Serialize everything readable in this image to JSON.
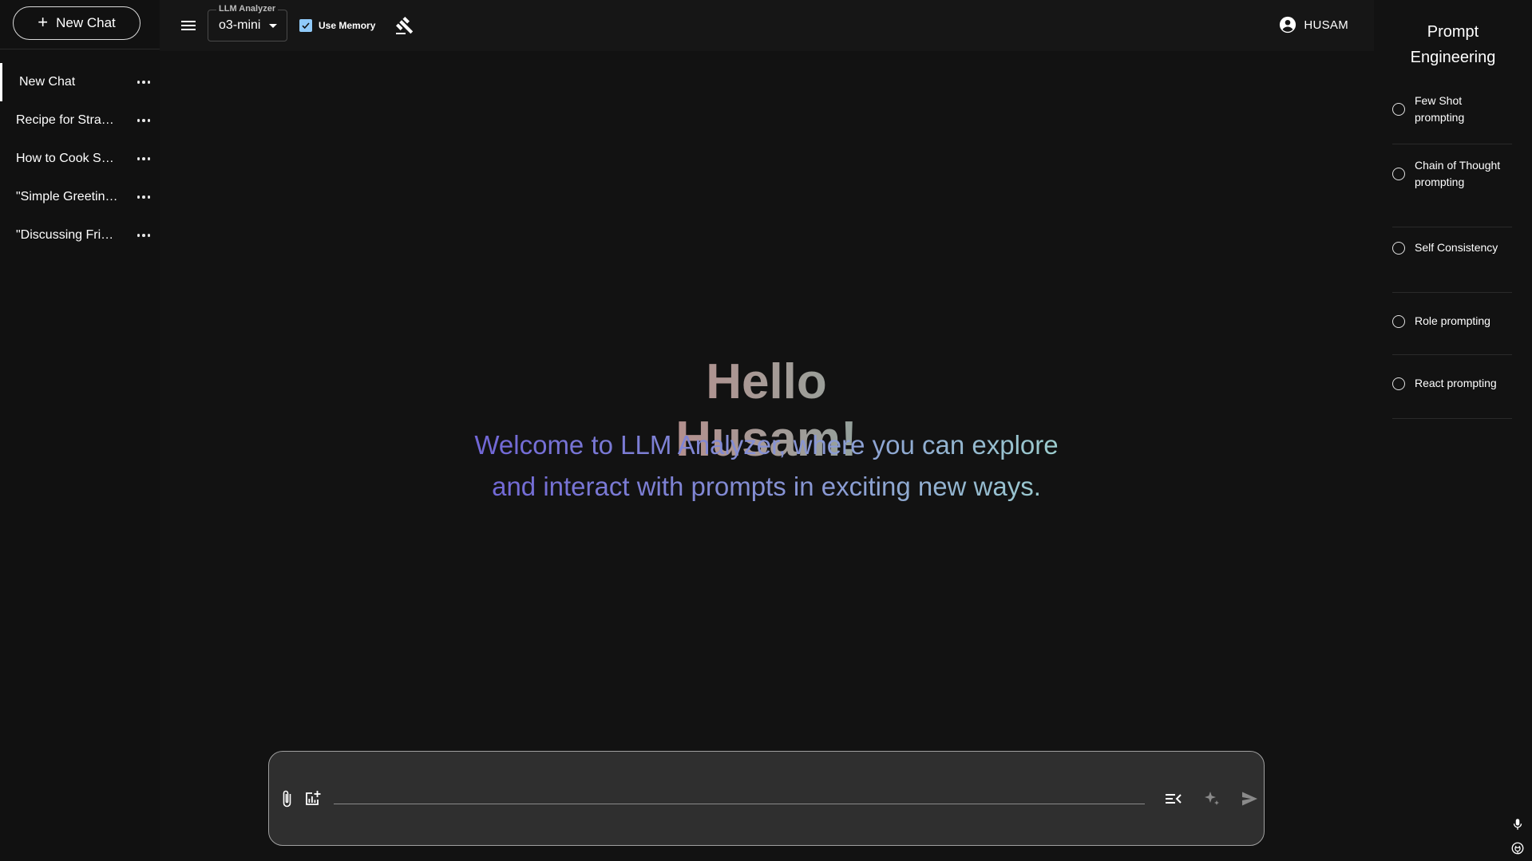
{
  "sidebar": {
    "new_chat_label": "New Chat",
    "chats": [
      {
        "title": "New Chat",
        "active": true
      },
      {
        "title": "Recipe for Stra…"
      },
      {
        "title": "How to Cook S…"
      },
      {
        "title": "\"Simple Greetin…"
      },
      {
        "title": "\"Discussing Fri…"
      }
    ]
  },
  "topbar": {
    "model_select_legend": "LLM Analyzer",
    "model_value": "o3-mini",
    "use_memory_label": "Use Memory",
    "use_memory_checked": true,
    "user_name": "HUSAM"
  },
  "main": {
    "greeting": "Hello Husam!",
    "welcome_line1": "Welcome to LLM Analyzer, where you can explore",
    "welcome_line2": "and interact with prompts in exciting new ways."
  },
  "composer": {
    "input_value": "",
    "input_placeholder": ""
  },
  "right_panel": {
    "title_line1": "Prompt",
    "title_line2": "Engineering",
    "techniques": [
      {
        "label": "Few Shot prompting"
      },
      {
        "label": "Chain of Thought prompting"
      },
      {
        "label": "Self Consistency"
      },
      {
        "label": "Role prompting"
      },
      {
        "label": "React prompting"
      }
    ]
  },
  "colors": {
    "background": "#121212",
    "checkbox_accent": "#90caf9",
    "greeting_gradient": [
      "#e8676d",
      "#a69a96",
      "#4dbdb0"
    ],
    "welcome_gradient": [
      "#6f62d6",
      "#8a9ad4",
      "#9ed3cd"
    ]
  },
  "icons": {
    "menu": "menu-icon",
    "gavel": "gavel-icon",
    "user": "account-circle-icon",
    "attach": "paperclip-icon",
    "add_chart": "add-chart-icon",
    "clear": "clear-list-icon",
    "enhance": "sparkle-icon",
    "send": "send-icon",
    "mic": "microphone-icon",
    "plugin": "plugin-icon"
  }
}
